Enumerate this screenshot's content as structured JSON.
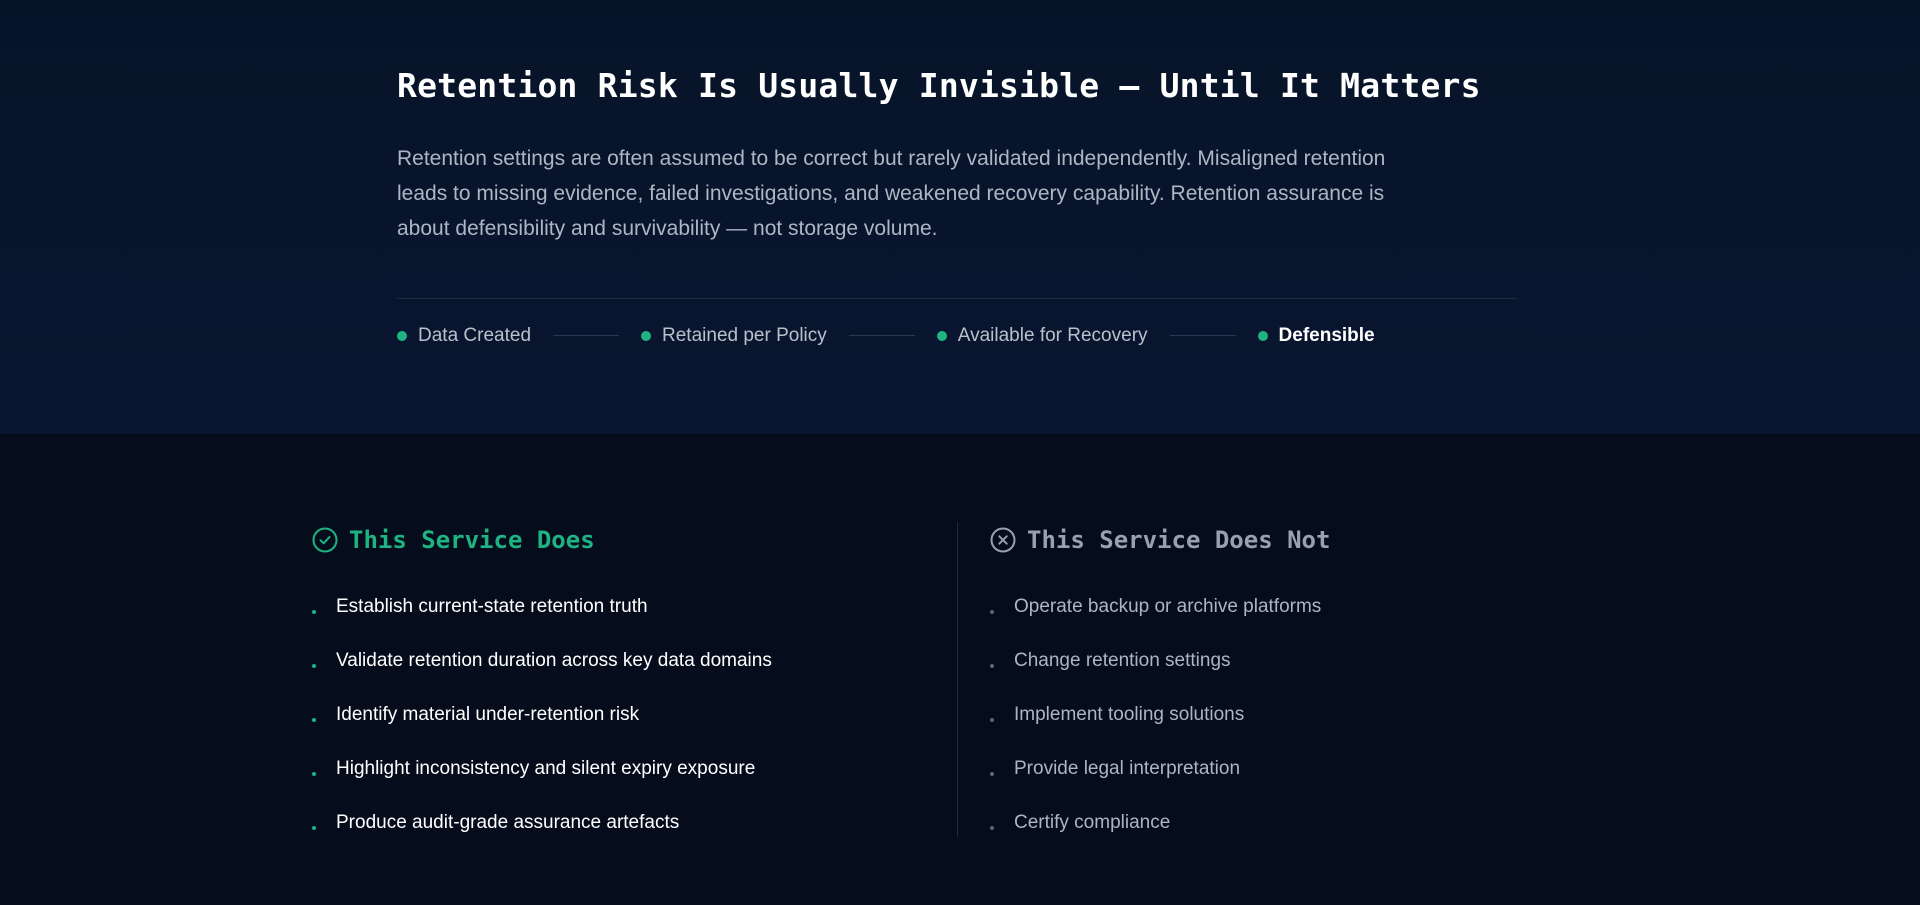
{
  "header": {
    "title": "Retention Risk Is Usually Invisible — Until It Matters",
    "intro": "Retention settings are often assumed to be correct but rarely validated independently. Misaligned retention leads to missing evidence, failed investigations, and weakened recovery capability. Retention assurance is about defensibility and survivability — not storage volume."
  },
  "flow": {
    "steps": [
      "Data Created",
      "Retained per Policy",
      "Available for Recovery",
      "Defensible"
    ]
  },
  "does": {
    "icon": "check-circle-icon",
    "title": "This Service Does",
    "items": [
      "Establish current-state retention truth",
      "Validate retention duration across key data domains",
      "Identify material under-retention risk",
      "Highlight inconsistency and silent expiry exposure",
      "Produce audit-grade assurance artefacts"
    ]
  },
  "does_not": {
    "icon": "x-circle-icon",
    "title": "This Service Does Not",
    "items": [
      "Operate backup or archive platforms",
      "Change retention settings",
      "Implement tooling solutions",
      "Provide legal interpretation",
      "Certify compliance"
    ]
  },
  "colors": {
    "accent": "#1db482",
    "background_top": "#071329",
    "background_bottom": "#050d1c",
    "muted": "#9aa1ad"
  }
}
